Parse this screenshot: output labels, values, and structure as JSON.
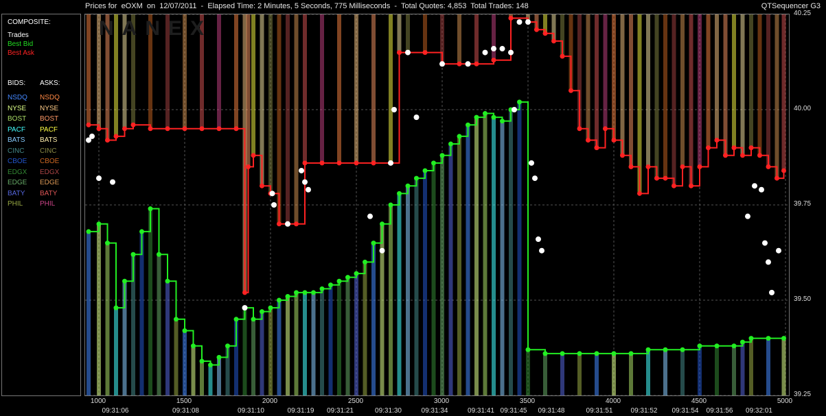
{
  "header": {
    "title": "Prices for  eOXM  on  12/07/2011  -  Elapsed Time: 2 Minutes, 5 Seconds, 775 Milliseconds  -  Total Quotes: 4,853  Total Trades: 148",
    "product": "QTSequencer G3"
  },
  "watermark": "NANEX",
  "legend": {
    "composite_title": "COMPOSITE:",
    "composite": [
      {
        "label": "Trades",
        "color": "#ffffff"
      },
      {
        "label": "Best Bid",
        "color": "#22dd22"
      },
      {
        "label": "Best Ask",
        "color": "#ff2222"
      }
    ],
    "bids_title": "BIDS:",
    "asks_title": "ASKS:",
    "exchanges": [
      {
        "bid": "NSDQ",
        "ask": "NSDQ",
        "bid_color": "#4488ff",
        "ask_color": "#ff8844"
      },
      {
        "bid": "NYSE",
        "ask": "NYSE",
        "bid_color": "#ddff88",
        "ask_color": "#ffcc88"
      },
      {
        "bid": "BOST",
        "ask": "BOST",
        "bid_color": "#aadd66",
        "ask_color": "#ff9966"
      },
      {
        "bid": "PACF",
        "ask": "PACF",
        "bid_color": "#44ffff",
        "ask_color": "#ffff44"
      },
      {
        "bid": "BATS",
        "ask": "BATS",
        "bid_color": "#88ccff",
        "ask_color": "#ffeeaa"
      },
      {
        "bid": "CINC",
        "ask": "CINC",
        "bid_color": "#448888",
        "ask_color": "#888844"
      },
      {
        "bid": "CBOE",
        "ask": "CBOE",
        "bid_color": "#2255cc",
        "ask_color": "#cc6622"
      },
      {
        "bid": "EDGX",
        "ask": "EDGX",
        "bid_color": "#338833",
        "ask_color": "#aa4444"
      },
      {
        "bid": "EDGE",
        "ask": "EDGE",
        "bid_color": "#66aa66",
        "ask_color": "#dd9955"
      },
      {
        "bid": "BATY",
        "ask": "BATY",
        "bid_color": "#5566dd",
        "ask_color": "#dd5555"
      },
      {
        "bid": "PHIL",
        "ask": "PHIL",
        "bid_color": "#99aa44",
        "ask_color": "#cc4488"
      }
    ]
  },
  "chart_data": {
    "type": "scatter",
    "title": "Prices for  eOXM  on  12/07/2011",
    "xlim": [
      920,
      5020
    ],
    "ylim": [
      39.25,
      40.25
    ],
    "grid": true,
    "y_ticks": [
      "40.25",
      "40.00",
      "39.75",
      "39.50",
      "39.25"
    ],
    "y_tick_values": [
      40.25,
      40.0,
      39.75,
      39.5,
      39.25
    ],
    "x_ticks": [
      "1000",
      "1500",
      "2000",
      "2500",
      "3000",
      "3500",
      "4000",
      "4500",
      "5000"
    ],
    "x_tick_values": [
      1000,
      1500,
      2000,
      2500,
      3000,
      3500,
      4000,
      4500,
      5000
    ],
    "time_ticks": [
      {
        "label": "09:31:06",
        "x": 1100
      },
      {
        "label": "09:31:08",
        "x": 1510
      },
      {
        "label": "09:31:10",
        "x": 1890
      },
      {
        "label": "09:31:19",
        "x": 2180
      },
      {
        "label": "09:31:21",
        "x": 2410
      },
      {
        "label": "09:31:30",
        "x": 2690
      },
      {
        "label": "09:31:34",
        "x": 2960
      },
      {
        "label": "09:31:41",
        "x": 3230
      },
      {
        "label": "09:31:45",
        "x": 3420
      },
      {
        "label": "09:31:48",
        "x": 3640
      },
      {
        "label": "09:31:51",
        "x": 3920
      },
      {
        "label": "09:31:52",
        "x": 4180
      },
      {
        "label": "09:31:54",
        "x": 4420
      },
      {
        "label": "09:31:56",
        "x": 4620
      },
      {
        "label": "09:32:01",
        "x": 4850
      }
    ],
    "series": [
      {
        "name": "Best Bid",
        "color": "#22ee22",
        "points": [
          [
            940,
            39.68
          ],
          [
            1000,
            39.7
          ],
          [
            1050,
            39.65
          ],
          [
            1100,
            39.48
          ],
          [
            1150,
            39.55
          ],
          [
            1200,
            39.62
          ],
          [
            1250,
            39.68
          ],
          [
            1300,
            39.74
          ],
          [
            1350,
            39.62
          ],
          [
            1400,
            39.55
          ],
          [
            1450,
            39.45
          ],
          [
            1500,
            39.42
          ],
          [
            1550,
            39.38
          ],
          [
            1600,
            39.34
          ],
          [
            1650,
            39.33
          ],
          [
            1700,
            39.35
          ],
          [
            1750,
            39.38
          ],
          [
            1800,
            39.45
          ],
          [
            1850,
            39.48
          ],
          [
            1900,
            39.45
          ],
          [
            1950,
            39.47
          ],
          [
            2000,
            39.48
          ],
          [
            2050,
            39.5
          ],
          [
            2100,
            39.51
          ],
          [
            2150,
            39.52
          ],
          [
            2200,
            39.52
          ],
          [
            2250,
            39.52
          ],
          [
            2300,
            39.53
          ],
          [
            2350,
            39.54
          ],
          [
            2400,
            39.55
          ],
          [
            2450,
            39.56
          ],
          [
            2500,
            39.57
          ],
          [
            2550,
            39.6
          ],
          [
            2600,
            39.65
          ],
          [
            2650,
            39.7
          ],
          [
            2700,
            39.75
          ],
          [
            2750,
            39.78
          ],
          [
            2800,
            39.8
          ],
          [
            2850,
            39.82
          ],
          [
            2900,
            39.84
          ],
          [
            2950,
            39.86
          ],
          [
            3000,
            39.88
          ],
          [
            3050,
            39.91
          ],
          [
            3100,
            39.93
          ],
          [
            3150,
            39.96
          ],
          [
            3200,
            39.98
          ],
          [
            3250,
            39.99
          ],
          [
            3300,
            39.98
          ],
          [
            3350,
            39.97
          ],
          [
            3400,
            40.0
          ],
          [
            3450,
            40.02
          ],
          [
            3500,
            39.37
          ],
          [
            3600,
            39.36
          ],
          [
            3700,
            39.36
          ],
          [
            3800,
            39.36
          ],
          [
            3900,
            39.36
          ],
          [
            4000,
            39.36
          ],
          [
            4100,
            39.36
          ],
          [
            4200,
            39.37
          ],
          [
            4300,
            39.37
          ],
          [
            4400,
            39.37
          ],
          [
            4500,
            39.38
          ],
          [
            4600,
            39.38
          ],
          [
            4700,
            39.38
          ],
          [
            4750,
            39.39
          ],
          [
            4800,
            39.4
          ],
          [
            4900,
            39.4
          ],
          [
            4990,
            39.4
          ]
        ]
      },
      {
        "name": "Best Ask",
        "color": "#ff2222",
        "points": [
          [
            940,
            39.96
          ],
          [
            1000,
            39.95
          ],
          [
            1050,
            39.92
          ],
          [
            1100,
            39.93
          ],
          [
            1150,
            39.95
          ],
          [
            1200,
            39.96
          ],
          [
            1300,
            39.95
          ],
          [
            1400,
            39.95
          ],
          [
            1500,
            39.95
          ],
          [
            1600,
            39.95
          ],
          [
            1700,
            39.95
          ],
          [
            1800,
            39.95
          ],
          [
            1850,
            39.52
          ],
          [
            1870,
            39.85
          ],
          [
            1900,
            39.88
          ],
          [
            1950,
            39.8
          ],
          [
            2000,
            39.78
          ],
          [
            2050,
            39.7
          ],
          [
            2100,
            39.7
          ],
          [
            2150,
            39.7
          ],
          [
            2200,
            39.86
          ],
          [
            2300,
            39.86
          ],
          [
            2400,
            39.86
          ],
          [
            2500,
            39.86
          ],
          [
            2600,
            39.86
          ],
          [
            2700,
            39.86
          ],
          [
            2750,
            40.15
          ],
          [
            2800,
            40.15
          ],
          [
            2900,
            40.15
          ],
          [
            3000,
            40.12
          ],
          [
            3100,
            40.12
          ],
          [
            3200,
            40.12
          ],
          [
            3300,
            40.13
          ],
          [
            3400,
            40.24
          ],
          [
            3500,
            40.23
          ],
          [
            3550,
            40.21
          ],
          [
            3600,
            40.2
          ],
          [
            3650,
            40.18
          ],
          [
            3700,
            40.14
          ],
          [
            3750,
            40.05
          ],
          [
            3800,
            39.95
          ],
          [
            3850,
            39.92
          ],
          [
            3900,
            39.9
          ],
          [
            3950,
            39.95
          ],
          [
            4000,
            39.92
          ],
          [
            4050,
            39.88
          ],
          [
            4100,
            39.85
          ],
          [
            4150,
            39.78
          ],
          [
            4200,
            39.85
          ],
          [
            4250,
            39.82
          ],
          [
            4300,
            39.82
          ],
          [
            4350,
            39.8
          ],
          [
            4400,
            39.85
          ],
          [
            4450,
            39.8
          ],
          [
            4500,
            39.85
          ],
          [
            4550,
            39.9
          ],
          [
            4600,
            39.92
          ],
          [
            4650,
            39.88
          ],
          [
            4700,
            39.9
          ],
          [
            4750,
            39.88
          ],
          [
            4800,
            39.9
          ],
          [
            4850,
            39.88
          ],
          [
            4900,
            39.85
          ],
          [
            4950,
            39.82
          ],
          [
            4990,
            39.84
          ]
        ]
      },
      {
        "name": "Trades",
        "color": "#ffffff",
        "points": [
          [
            940,
            39.92
          ],
          [
            960,
            39.93
          ],
          [
            1000,
            39.82
          ],
          [
            1080,
            39.81
          ],
          [
            1850,
            39.48
          ],
          [
            2010,
            39.78
          ],
          [
            2020,
            39.75
          ],
          [
            2100,
            39.7
          ],
          [
            2180,
            39.84
          ],
          [
            2200,
            39.81
          ],
          [
            2220,
            39.79
          ],
          [
            2580,
            39.72
          ],
          [
            2650,
            39.63
          ],
          [
            2700,
            39.86
          ],
          [
            2720,
            40.0
          ],
          [
            2800,
            40.15
          ],
          [
            2850,
            39.98
          ],
          [
            3000,
            40.12
          ],
          [
            3150,
            40.12
          ],
          [
            3250,
            40.15
          ],
          [
            3300,
            40.16
          ],
          [
            3350,
            40.16
          ],
          [
            3400,
            40.15
          ],
          [
            3420,
            40.0
          ],
          [
            3450,
            40.23
          ],
          [
            3500,
            40.23
          ],
          [
            3520,
            39.86
          ],
          [
            3540,
            39.82
          ],
          [
            3560,
            39.66
          ],
          [
            3580,
            39.63
          ],
          [
            4780,
            39.72
          ],
          [
            4820,
            39.8
          ],
          [
            4860,
            39.79
          ],
          [
            4880,
            39.65
          ],
          [
            4900,
            39.6
          ],
          [
            4920,
            39.52
          ],
          [
            4960,
            39.63
          ]
        ]
      }
    ]
  }
}
